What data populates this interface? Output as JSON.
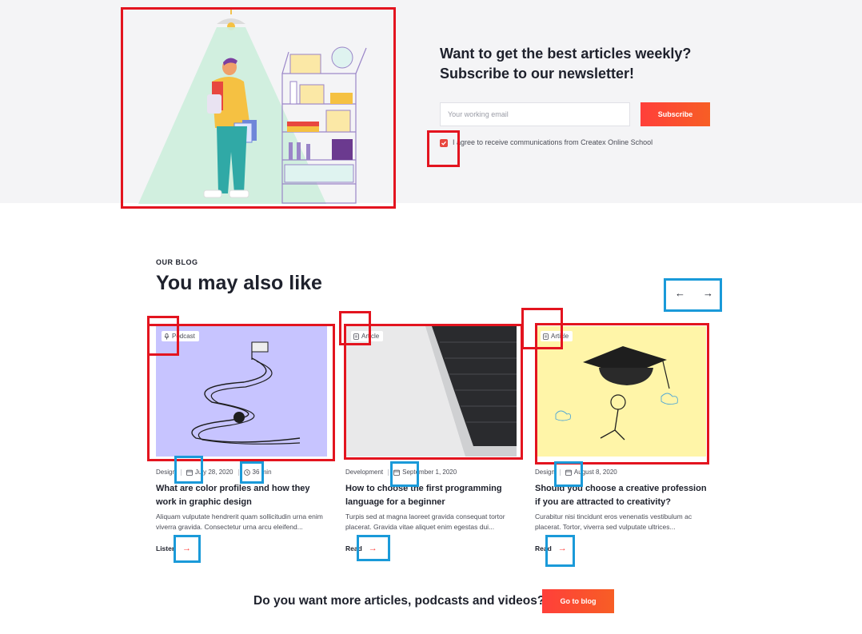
{
  "newsletter": {
    "title_line1": "Want to get the best articles weekly?",
    "title_line2": "Subscribe to our newsletter!",
    "email_placeholder": "Your working email",
    "subscribe_label": "Subscribe",
    "agree_label": "I agree to receive communications from Createx Online School",
    "agree_checked": true
  },
  "blog": {
    "eyebrow": "OUR BLOG",
    "heading": "You may also like",
    "prev_arrow": "←",
    "next_arrow": "→",
    "cards": [
      {
        "badge": "Podcast",
        "badge_icon": "microphone-icon",
        "category": "Design",
        "date": "July 28, 2020",
        "duration": "36 min",
        "title": "What are color profiles and how they work in graphic design",
        "excerpt": "Aliquam vulputate hendrerit quam sollicitudin urna enim viverra gravida. Consectetur urna arcu eleifend...",
        "link_label": "Listen",
        "image_bg": "#c7c4ff"
      },
      {
        "badge": "Article",
        "badge_icon": "document-icon",
        "category": "Development",
        "date": "September 1, 2020",
        "title": "How to choose the first programming language for a beginner",
        "excerpt": "Turpis sed at magna laoreet gravida consequat tortor placerat. Gravida vitae aliquet enim egestas dui...",
        "link_label": "Read",
        "image_bg": "#e9e9ea"
      },
      {
        "badge": "Article",
        "badge_icon": "document-icon",
        "category": "Design",
        "date": "August 8, 2020",
        "title": "Should you choose a creative profession if you are attracted to creativity?",
        "excerpt": "Curabitur nisi tincidunt eros venenatis vestibulum ac placerat. Tortor, viverra sed vulputate ultrices...",
        "link_label": "Read",
        "image_bg": "#fff5a8"
      }
    ]
  },
  "cta": {
    "text": "Do you want more articles, podcasts and videos?",
    "button_label": "Go to blog"
  },
  "colors": {
    "accent": "#ff3f3a",
    "annotation_red": "#e3141f",
    "annotation_blue": "#1a9ad9"
  }
}
